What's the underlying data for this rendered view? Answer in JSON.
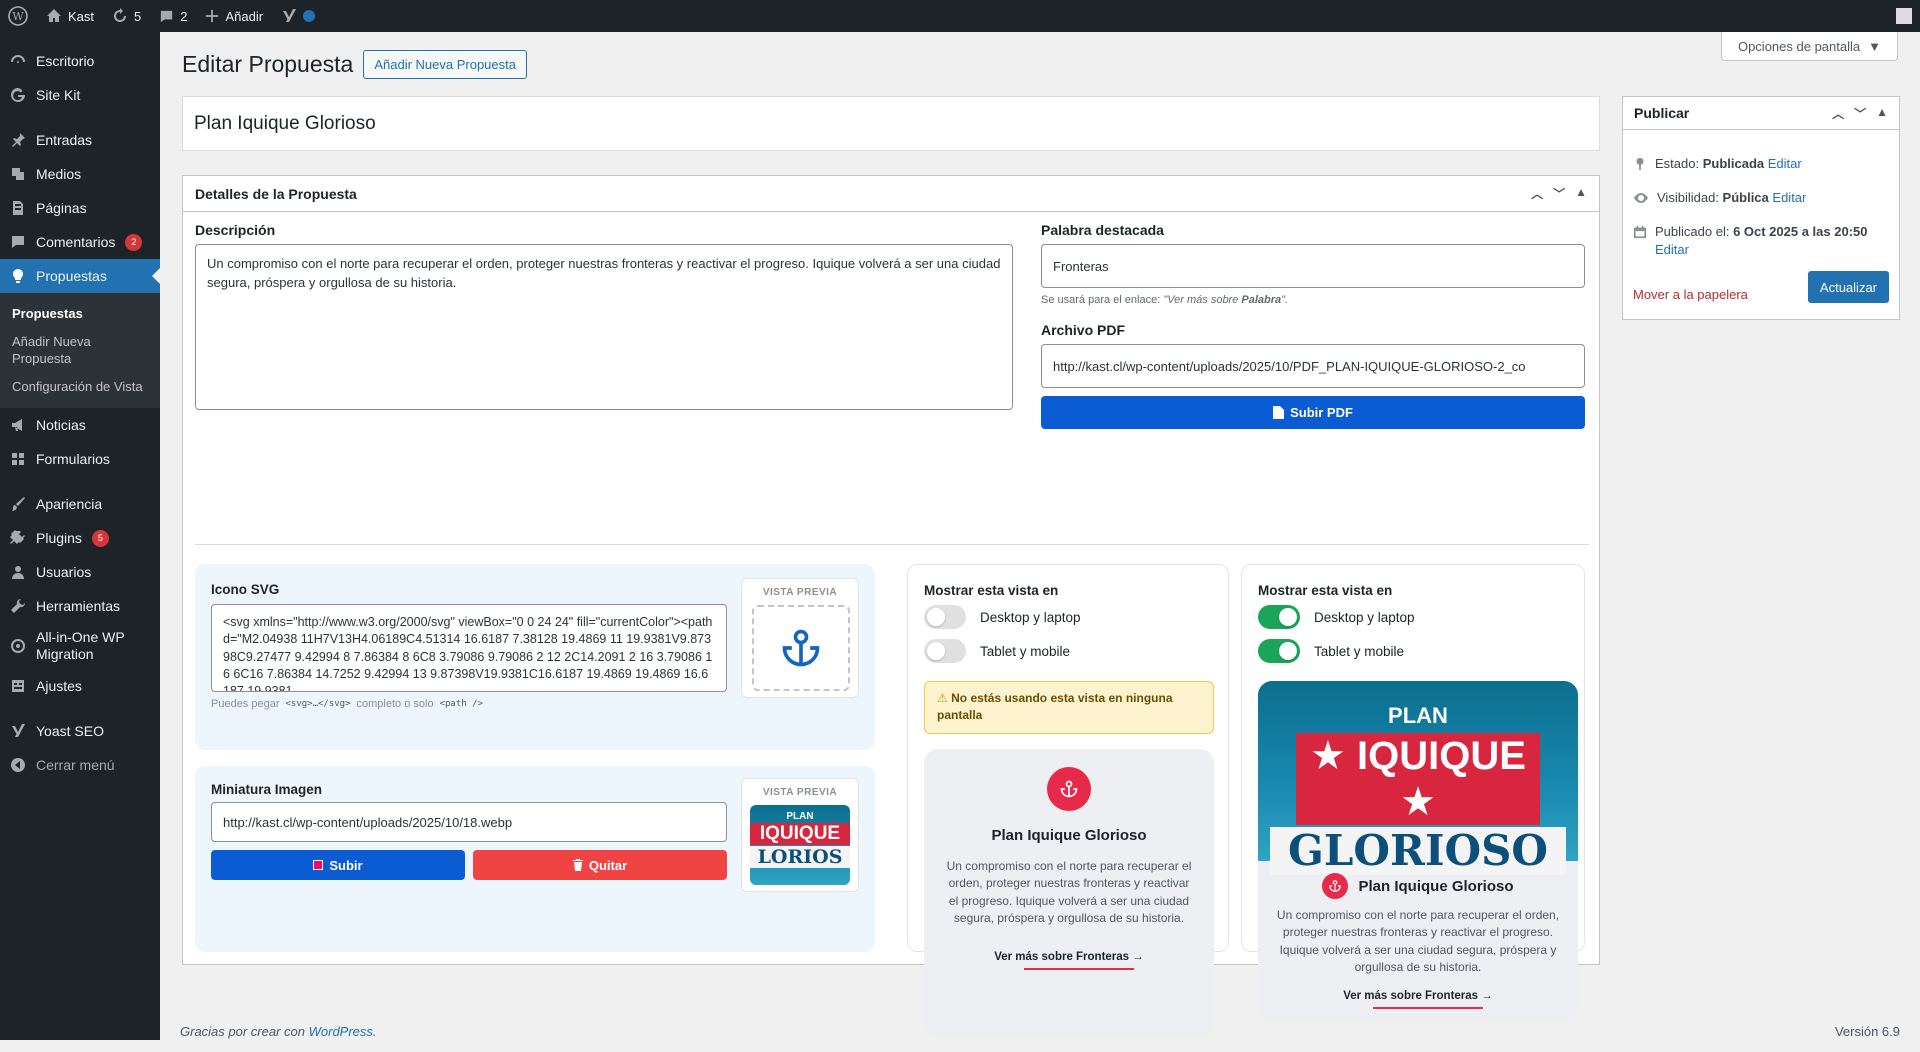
{
  "adminbar": {
    "site": "Kast",
    "updates": "5",
    "comments": "2",
    "add": "Añadir"
  },
  "sidebar": {
    "items": [
      {
        "label": "Escritorio",
        "icon": "dashboard-icon"
      },
      {
        "label": "Site Kit",
        "icon": "google-icon"
      },
      {
        "label": "Entradas",
        "icon": "pin-icon"
      },
      {
        "label": "Medios",
        "icon": "media-icon"
      },
      {
        "label": "Páginas",
        "icon": "page-icon"
      },
      {
        "label": "Comentarios",
        "icon": "comment-icon",
        "badge": "2"
      },
      {
        "label": "Propuestas",
        "icon": "lightbulb-icon"
      },
      {
        "label": "Noticias",
        "icon": "megaphone-icon"
      },
      {
        "label": "Formularios",
        "icon": "grid-icon"
      },
      {
        "label": "Apariencia",
        "icon": "brush-icon"
      },
      {
        "label": "Plugins",
        "icon": "plug-icon",
        "badge": "5"
      },
      {
        "label": "Usuarios",
        "icon": "user-icon"
      },
      {
        "label": "Herramientas",
        "icon": "wrench-icon"
      },
      {
        "label": "All-in-One WP Migration",
        "icon": "migration-icon"
      },
      {
        "label": "Ajustes",
        "icon": "settings-icon"
      },
      {
        "label": "Yoast SEO",
        "icon": "yoast-icon"
      },
      {
        "label": "Cerrar menú",
        "icon": "collapse-icon"
      }
    ],
    "submenu": [
      "Propuestas",
      "Añadir Nueva Propuesta",
      "Configuración de Vista"
    ]
  },
  "screen_options": "Opciones de pantalla",
  "page": {
    "title": "Editar Propuesta",
    "add_new": "Añadir Nueva Propuesta",
    "post_title": "Plan Iquique Glorioso"
  },
  "details": {
    "header": "Detalles de la Propuesta",
    "description_label": "Descripción",
    "description": "Un compromiso con el norte para recuperar el orden, proteger nuestras fronteras y reactivar el progreso. Iquique volverá a ser una ciudad segura, próspera y orgullosa de su historia.",
    "keyword_label": "Palabra destacada",
    "keyword": "Fronteras",
    "keyword_hint_prefix": "Se usará para el enlace: ",
    "keyword_hint_example": "\"Ver más sobre ",
    "keyword_hint_bold": "Palabra",
    "keyword_hint_end": "\".",
    "pdf_label": "Archivo PDF",
    "pdf_url": "http://kast.cl/wp-content/uploads/2025/10/PDF_PLAN-IQUIQUE-GLORIOSO-2_co",
    "pdf_button": "Subir PDF",
    "svg_label": "Icono SVG",
    "svg_code": "<svg xmlns=\"http://www.w3.org/2000/svg\" viewBox=\"0 0 24 24\" fill=\"currentColor\"><path d=\"M2.04938 11H7V13H4.06189C4.51314 16.6187 7.38128 19.4869 11 19.9381V9.87398C9.27477 9.42994 8 7.86384 8 6C8 3.79086 9.79086 2 12 2C14.2091 2 16 3.79086 16 6C16 7.86384 14.7252 9.42994 13 9.87398V19.9381C16.6187 19.4869 19.4869 16.6187 19.9381",
    "svg_hint_1": "Puedes pegar",
    "svg_hint_code1": "<svg>…</svg>",
    "svg_hint_2": "completo o solo",
    "svg_hint_code2": "<path />",
    "preview_label": "VISTA PREVIA",
    "thumb_label": "Miniatura Imagen",
    "thumb_url": "http://kast.cl/wp-content/uploads/2025/10/18.webp",
    "upload_button": "Subir",
    "remove_button": "Quitar"
  },
  "view1": {
    "title": "Mostrar esta vista en",
    "desktop": "Desktop y laptop",
    "mobile": "Tablet y mobile",
    "warning": "No estás usando esta vista en ninguna pantalla"
  },
  "view2": {
    "title": "Mostrar esta vista en",
    "desktop": "Desktop y laptop",
    "mobile": "Tablet y mobile"
  },
  "card": {
    "title": "Plan Iquique Glorioso",
    "desc": "Un compromiso con el norte para recuperar el orden, proteger nuestras fronteras y reactivar el progreso. Iquique volverá a ser una ciudad segura, próspera y orgullosa de su historia.",
    "link_prefix": "Ver más sobre ",
    "link_word": "Fronteras"
  },
  "banner": {
    "line1": "PLAN",
    "line2": "IQUIQUE",
    "line3": "GLORIOSO",
    "thumb2": "IQUIQUE",
    "thumb3": "LORIOS"
  },
  "publish": {
    "header": "Publicar",
    "status_label": "Estado: ",
    "status": "Publicada",
    "visibility_label": "Visibilidad: ",
    "visibility": "Pública",
    "published_label": "Publicado el: ",
    "published": "6 Oct 2025 a las 20:50",
    "edit": "Editar",
    "trash": "Mover a la papelera",
    "update": "Actualizar"
  },
  "footer": {
    "text": "Gracias por crear con ",
    "link": "WordPress",
    "end": ".",
    "version": "Versión 6.9"
  },
  "colors": {
    "accent": "#2271b1",
    "primary_button": "#0b5bd3",
    "danger": "#f04444",
    "toggle_on": "#1aa55b",
    "brand_red": "#e82a4a"
  }
}
